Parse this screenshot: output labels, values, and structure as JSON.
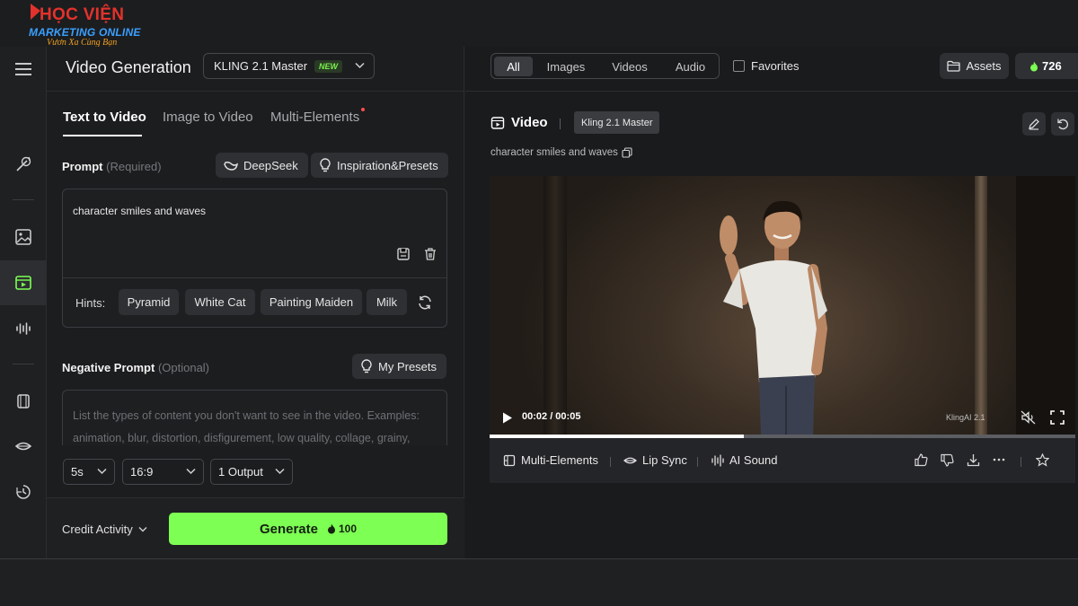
{
  "logo": {
    "line1": "HỌC VIỆN",
    "line2": "MARKETING ONLINE",
    "line3": "Vươn Xa Cùng Bạn"
  },
  "left_panel": {
    "title": "Video Generation",
    "model": "KLING 2.1 Master",
    "model_badge": "NEW",
    "tabs": [
      {
        "label": "Text to Video",
        "active": true
      },
      {
        "label": "Image to Video",
        "active": false
      },
      {
        "label": "Multi-Elements",
        "active": false,
        "has_dot": true
      }
    ],
    "prompt": {
      "label": "Prompt",
      "hint": "(Required)",
      "deepseek_label": "DeepSeek",
      "presets_label": "Inspiration&Presets",
      "value": "character smiles and waves",
      "hints_label": "Hints:",
      "hints": [
        "Pyramid",
        "White Cat",
        "Painting Maiden",
        "Milk"
      ]
    },
    "negative_prompt": {
      "label": "Negative Prompt",
      "hint": "(Optional)",
      "my_presets_label": "My Presets",
      "placeholder": "List the types of content you don't want to see in the video. Examples: animation, blur, distortion, disfigurement, low quality, collage, grainy,"
    },
    "options": {
      "duration": "5s",
      "aspect_ratio": "16:9",
      "outputs": "1 Output"
    },
    "footer": {
      "credit_label": "Credit Activity",
      "generate_label": "Generate",
      "generate_cost": "100"
    }
  },
  "right_panel": {
    "filters": [
      {
        "label": "All",
        "active": true
      },
      {
        "label": "Images",
        "active": false
      },
      {
        "label": "Videos",
        "active": false
      },
      {
        "label": "Audio",
        "active": false
      }
    ],
    "favorites_label": "Favorites",
    "assets_label": "Assets",
    "credits": "726",
    "video": {
      "title": "Video",
      "model": "Kling 2.1 Master",
      "caption": "character smiles and waves",
      "time": "00:02 / 00:05",
      "watermark": "KlingAI 2.1",
      "progress": 0.434
    },
    "actions": {
      "multi_elements": "Multi-Elements",
      "lip_sync": "Lip Sync",
      "ai_sound": "AI Sound"
    }
  },
  "colors": {
    "accent": "#7dff53",
    "background": "#1c1d1f",
    "panel": "#2e3033"
  }
}
